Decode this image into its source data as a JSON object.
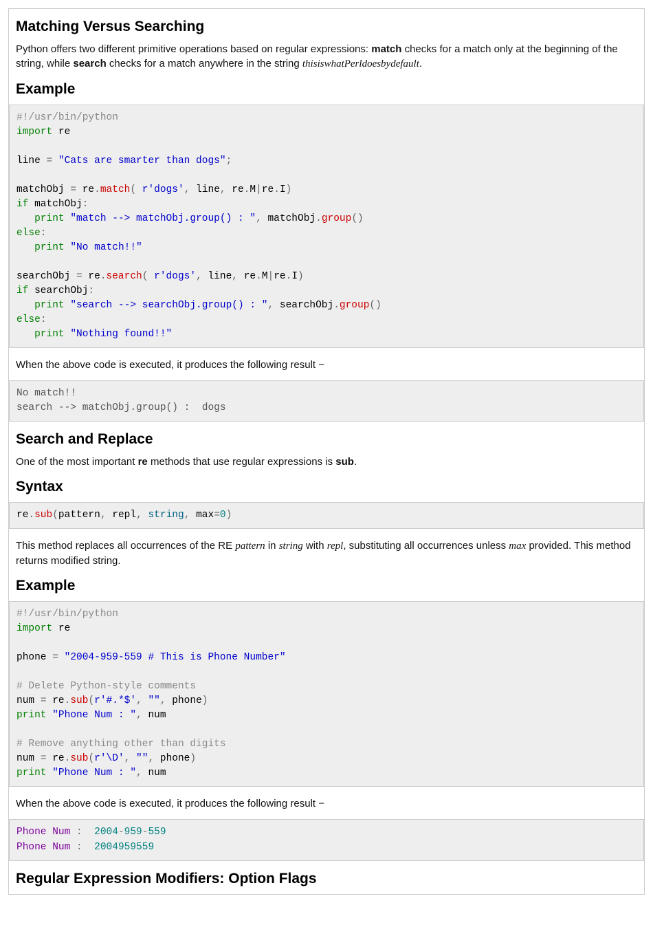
{
  "headings": {
    "h1": "Matching Versus Searching",
    "h2": "Example",
    "h3": "Search and Replace",
    "h4": "Syntax",
    "h5": "Example",
    "h6": "Regular Expression Modifiers: Option Flags"
  },
  "paragraphs": {
    "p1_a": "Python offers two different primitive operations based on regular expressions: ",
    "p1_bold1": "match",
    "p1_b": " checks for a match only at the beginning of the string, while ",
    "p1_bold2": "search",
    "p1_c": " checks for a match anywhere in the string ",
    "p1_italic": "thisiswhatPerldoesbydefault",
    "p1_d": ".",
    "p2": "When the above code is executed, it produces the following result −",
    "p3_a": "One of the most important ",
    "p3_bold1": "re",
    "p3_b": " methods that use regular expressions is ",
    "p3_bold2": "sub",
    "p3_c": ".",
    "p4_a": "This method replaces all occurrences of the RE ",
    "p4_i1": "pattern",
    "p4_b": " in ",
    "p4_i2": "string",
    "p4_c": " with ",
    "p4_i3": "repl",
    "p4_d": ", substituting all occurrences unless ",
    "p4_i4": "max",
    "p4_e": " provided. This method returns modified string.",
    "p5": "When the above code is executed, it produces the following result −"
  },
  "code1": {
    "shebang": "#!/usr/bin/python",
    "import": "import",
    "re": " re",
    "line_var": "line ",
    "eq": "=",
    "line_str": " \"Cats are smarter than dogs\"",
    "semi": ";",
    "matchObj": "matchObj ",
    "re2": " re",
    "dot": ".",
    "match": "match",
    "paren_open": "(",
    "sp": " ",
    "r_dogs": "r'dogs'",
    "comma": ",",
    "line_arg": " line",
    "re3": " re",
    "M": "M",
    "pipe": "|",
    "re4": "re",
    "I": "I",
    "paren_close": ")",
    "if": "if",
    "matchObj2": " matchObj",
    "colon": ":",
    "indent": "   ",
    "print": "print",
    "match_str": " \"match --> matchObj.group() : \"",
    "matchObj3": " matchObj",
    "group": "group",
    "parens": "()",
    "else": "else",
    "nomatch_str": " \"No match!!\"",
    "searchObj": "searchObj ",
    "search": "search",
    "searchObj2": " searchObj",
    "search_str": " \"search --> searchObj.group() : \"",
    "searchObj3": " searchObj",
    "nothing_str": " \"Nothing found!!\""
  },
  "output1": "No match!!\nsearch --> matchObj.group() :  dogs",
  "code2": {
    "re": "re",
    "dot": ".",
    "sub": "sub",
    "open": "(",
    "pattern": "pattern",
    "comma": ",",
    "repl": " repl",
    "string": " string",
    "max": " max",
    "eq": "=",
    "zero": "0",
    "close": ")"
  },
  "code3": {
    "shebang": "#!/usr/bin/python",
    "import": "import",
    "re": " re",
    "phone": "phone ",
    "eq": "=",
    "phone_str": " \"2004-959-559 # This is Phone Number\"",
    "comment1": "# Delete Python-style comments",
    "num": "num ",
    "re2": " re",
    "dot": ".",
    "sub": "sub",
    "open": "(",
    "pat1": "r'#.*$'",
    "comma": ",",
    "empty": " \"\"",
    "phone_arg": " phone",
    "close": ")",
    "print": "print",
    "print_str": " \"Phone Num : \"",
    "num_arg": " num",
    "comment2": "# Remove anything other than digits",
    "pat2": "r'\\D'"
  },
  "output2_l1a": "Phone",
  "output2_l1b": " Num ",
  "output2_l1c": ":",
  "output2_l1d": "  2004",
  "output2_l1e": "-",
  "output2_l1f": "959",
  "output2_l1g": "-",
  "output2_l1h": "559",
  "output2_l2a": "Phone",
  "output2_l2b": " Num ",
  "output2_l2c": ":",
  "output2_l2d": "  2004959559"
}
